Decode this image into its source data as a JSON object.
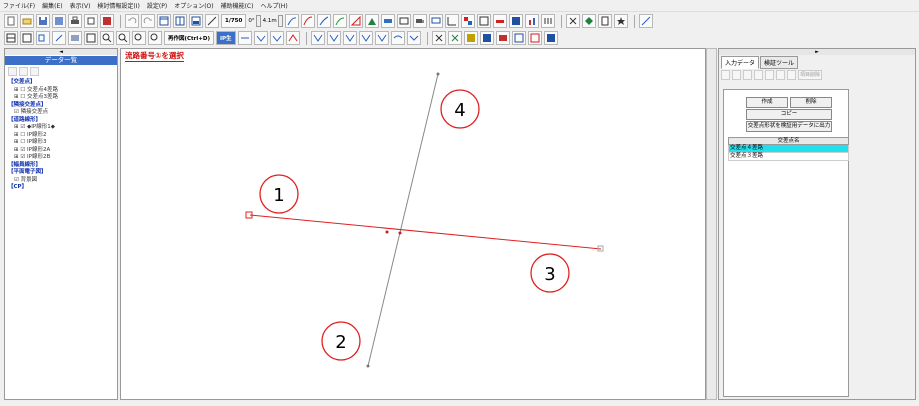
{
  "menu": [
    "ファイル(F)",
    "編集(E)",
    "表示(V)",
    "検討情報設定(I)",
    "設定(P)",
    "オプション(O)",
    "補助機能(C)",
    "ヘルプ(H)"
  ],
  "toolbar": {
    "scale_value": "1/750",
    "angle_value": "0°",
    "dist_value": "4.1m",
    "redraw_label": "再作図(Ctrl+D)",
    "ip_label": "IP生"
  },
  "left_panel": {
    "header_arrow": "◄",
    "title": "データ一覧",
    "tree": [
      {
        "text": "【交差点】",
        "level": 0,
        "group": true
      },
      {
        "text": "⊞ ☐ 交差点4差路",
        "level": 1,
        "group": false
      },
      {
        "text": "⊞ ☐ 交差点3差路",
        "level": 1,
        "group": false
      },
      {
        "text": "【隣接交差点】",
        "level": 0,
        "group": true
      },
      {
        "text": "☑ 隣接交差点",
        "level": 1,
        "group": false
      },
      {
        "text": "【道路線形】",
        "level": 0,
        "group": true
      },
      {
        "text": "⊞ ☑ ◆IP線形1◆",
        "level": 1,
        "group": false
      },
      {
        "text": "⊞ ☐ IP線形2",
        "level": 1,
        "group": false
      },
      {
        "text": "⊞ ☐ IP線形3",
        "level": 1,
        "group": false
      },
      {
        "text": "⊞ ☑ IP線形2A",
        "level": 1,
        "group": false
      },
      {
        "text": "⊞ ☑ IP線形2B",
        "level": 1,
        "group": false
      },
      {
        "text": "【幅員線形】",
        "level": 0,
        "group": true
      },
      {
        "text": "【平面電子図】",
        "level": 0,
        "group": true
      },
      {
        "text": "☑ 背景図",
        "level": 1,
        "group": false
      },
      {
        "text": "【CP】",
        "level": 0,
        "group": true
      }
    ]
  },
  "canvas": {
    "instruction": "流路番号①を選択",
    "markers": [
      "1",
      "2",
      "3",
      "4"
    ]
  },
  "right_panel": {
    "header_arrow": "►",
    "tabs": [
      "入力データ",
      "検証ツール"
    ],
    "tool_last": "項目削除",
    "create_label": "作成",
    "delete_label": "削除",
    "copy_label": "コピー",
    "export_label": "交差点形状を検証用データに出力",
    "table_header": "交差点名",
    "rows": [
      "交差点４差路",
      "交差点３差路"
    ]
  },
  "colors": {
    "accent": "#3b6fc8",
    "red_line": "#e02020",
    "selected_row": "#20e0f0"
  }
}
